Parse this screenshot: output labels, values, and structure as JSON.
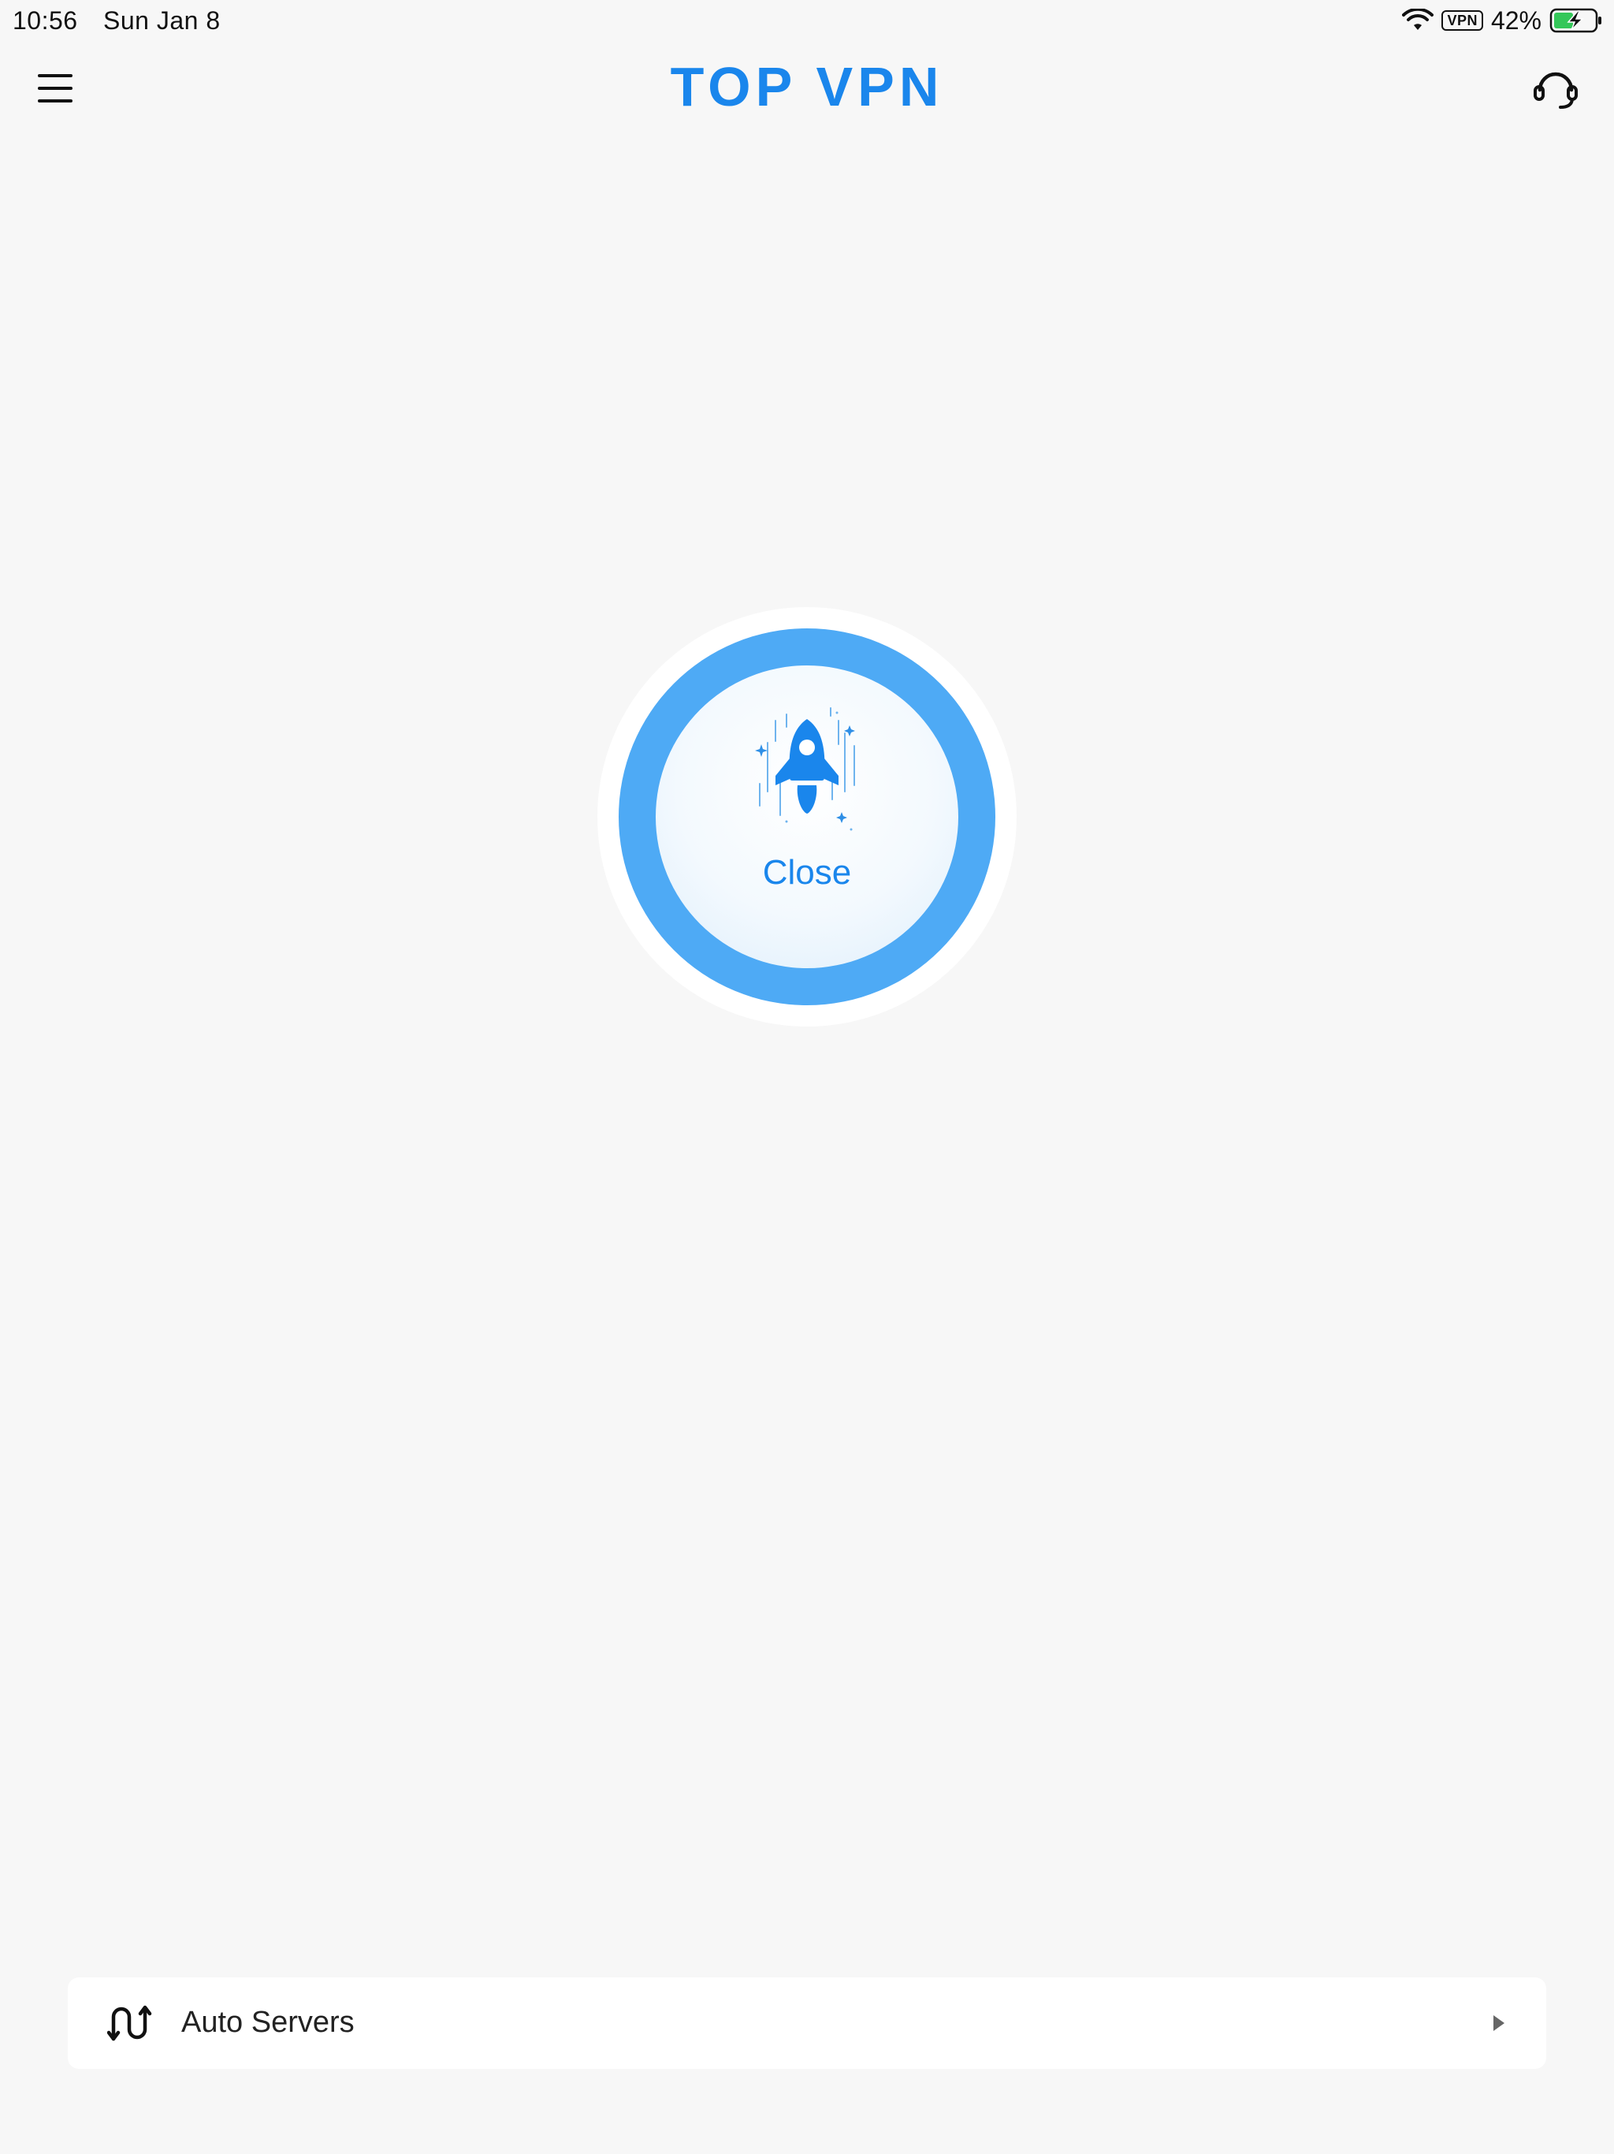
{
  "status_bar": {
    "time": "10:56",
    "date": "Sun Jan 8",
    "vpn_badge": "VPN",
    "battery": "42%",
    "icons": [
      "wifi-icon",
      "battery-charging-icon"
    ]
  },
  "header": {
    "title": "TOP VPN",
    "left_icon": "hamburger-menu-icon",
    "right_icon": "headset-support-icon"
  },
  "connect_button": {
    "label": "Close",
    "icon": "rocket-icon"
  },
  "server_selector": {
    "label": "Auto Servers",
    "left_icon": "route-switch-icon",
    "right_icon": "play-arrow-icon"
  },
  "colors": {
    "accent": "#1a86ec",
    "ring": "#4eaaf5",
    "background": "#f7f7f7",
    "battery_green": "#34c759"
  }
}
